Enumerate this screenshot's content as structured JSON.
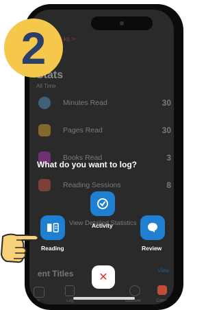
{
  "step_number": "2",
  "background": {
    "top_link": "ks",
    "stats_title": "Stats",
    "stats_subtitle": "All Time",
    "rows": [
      {
        "label": "Minutes Read",
        "value": "30"
      },
      {
        "label": "Pages Read",
        "value": "30"
      },
      {
        "label": "Books Read",
        "value": "3"
      },
      {
        "label": "Reading Sessions",
        "value": "8"
      }
    ],
    "details_link": "View Detailed Statistics",
    "recent_titles": "ent Titles",
    "view_all": "View"
  },
  "modal": {
    "prompt": "What do you want to log?",
    "actions": [
      {
        "label": "Activity",
        "icon": "check-circle-icon"
      },
      {
        "label": "Reading",
        "icon": "book-icon"
      },
      {
        "label": "Review",
        "icon": "chat-bubble-icon"
      }
    ],
    "close_icon": "close-icon"
  },
  "tabbar": {
    "items": [
      {
        "label": "me"
      },
      {
        "label": "Log"
      },
      {
        "label": "Discover"
      },
      {
        "label": "Comm"
      }
    ]
  },
  "colors": {
    "accent": "#1f7fd0",
    "badge": "#f5c84c",
    "badge_text": "#2a3f6a",
    "close": "#e23030"
  }
}
